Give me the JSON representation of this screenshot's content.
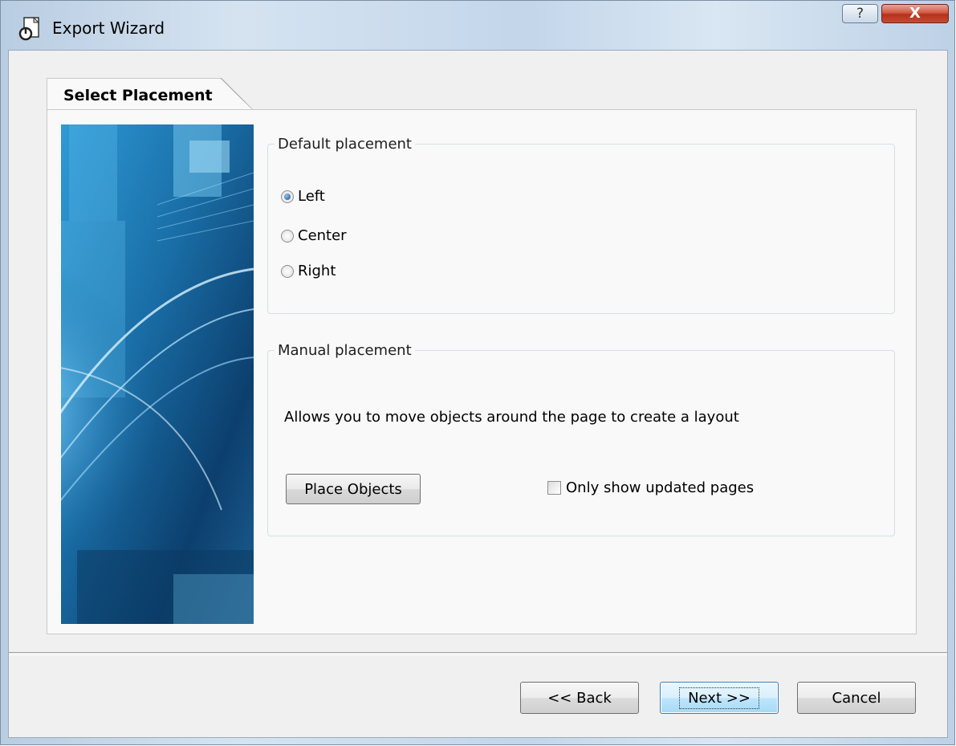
{
  "window": {
    "title": "Export Wizard",
    "help_glyph": "?",
    "close_glyph": "X"
  },
  "tab": {
    "label": "Select Placement"
  },
  "default_placement": {
    "legend": "Default placement",
    "options": [
      {
        "label": "Left",
        "checked": true
      },
      {
        "label": "Center",
        "checked": false
      },
      {
        "label": "Right",
        "checked": false
      }
    ]
  },
  "manual_placement": {
    "legend": "Manual placement",
    "description": "Allows you to move objects around the page to create a layout",
    "place_button": "Place Objects",
    "only_updated_label": "Only show updated pages",
    "only_updated_checked": false
  },
  "footer": {
    "back_label": "<< Back",
    "next_label": "Next >>",
    "cancel_label": "Cancel"
  },
  "icons": {
    "title": "export-wizard-icon",
    "help": "help-icon",
    "close": "close-icon"
  },
  "colors": {
    "client_bg": "#f0f0f0",
    "close_red": "#c84a32",
    "default_button_blue": "#3c7fb1",
    "side_image_blue": "#1a6fa8"
  }
}
